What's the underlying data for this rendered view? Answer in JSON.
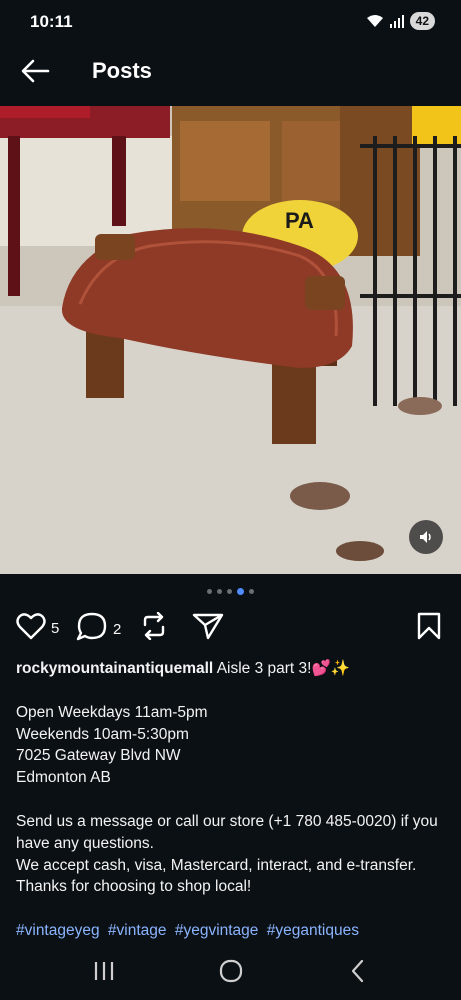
{
  "status_bar": {
    "time": "10:11",
    "battery": "42",
    "icons": [
      "wifi-icon",
      "signal-icon",
      "battery-icon"
    ]
  },
  "header": {
    "back_icon": "arrow-left-icon",
    "title": "Posts"
  },
  "post": {
    "carousel": {
      "total": 5,
      "active_index": 3
    },
    "likes": "5",
    "comments": "2",
    "icons": [
      "heart-icon",
      "comment-icon",
      "repost-icon",
      "send-icon",
      "bookmark-icon",
      "speaker-icon"
    ],
    "username": "rockymountainantiquemall",
    "caption_first": "Aisle 3 part 3!💕✨",
    "hours": [
      "Open Weekdays 11am-5pm",
      "Weekends 10am-5:30pm",
      "7025 Gateway Blvd NW",
      "Edmonton AB"
    ],
    "info": [
      "Send us a message or call our store (+1 780 485-0020) if you have any questions.",
      "We accept cash, visa, Mastercard, interact, and e-transfer.",
      "Thanks for choosing to shop local!"
    ],
    "hashtags": [
      "#vintageyeg",
      "#vintage",
      "#yegvintage",
      "#yegantiques"
    ],
    "photo_sign_text": "PA"
  },
  "nav_bar": {
    "icons": [
      "recents-icon",
      "home-icon",
      "back-icon"
    ]
  }
}
